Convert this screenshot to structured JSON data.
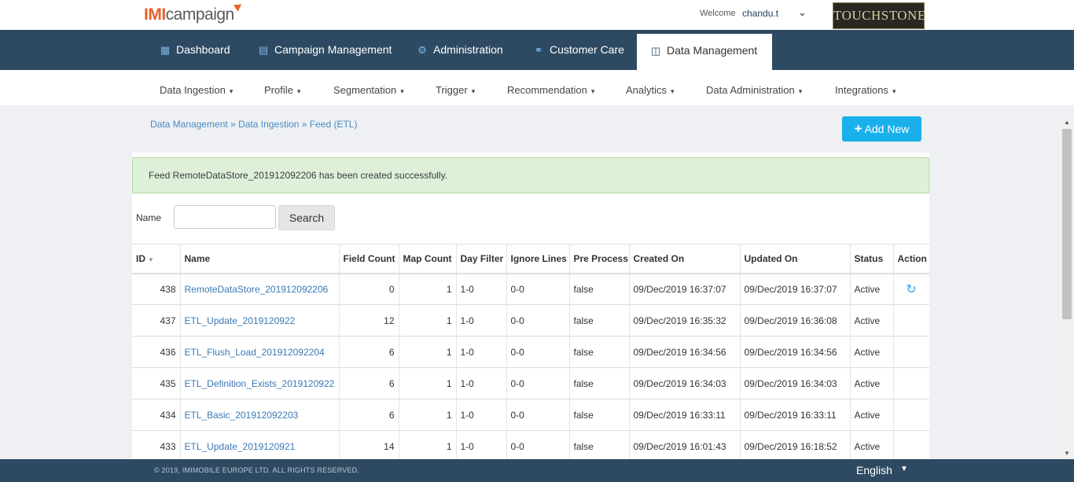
{
  "header": {
    "logo_imi": "IMI",
    "logo_campaign": "campaign",
    "welcome_label": "Welcome",
    "username": "chandu.t",
    "brand": "TOUCHSTONE"
  },
  "main_nav": {
    "items": [
      {
        "label": "Dashboard",
        "icon": "bar-chart-icon"
      },
      {
        "label": "Campaign Management",
        "icon": "document-icon"
      },
      {
        "label": "Administration",
        "icon": "gears-icon"
      },
      {
        "label": "Customer Care",
        "icon": "headset-icon"
      },
      {
        "label": "Data Management",
        "icon": "database-icon",
        "active": true
      }
    ]
  },
  "sub_nav": {
    "items": [
      {
        "label": "Data Ingestion"
      },
      {
        "label": "Profile"
      },
      {
        "label": "Segmentation"
      },
      {
        "label": "Trigger"
      },
      {
        "label": "Recommendation"
      },
      {
        "label": "Analytics"
      },
      {
        "label": "Data Administration"
      },
      {
        "label": "Integrations"
      }
    ]
  },
  "breadcrumb": "Data Management » Data Ingestion » Feed (ETL)",
  "add_new_label": "Add New",
  "alert_text": "Feed RemoteDataStore_201912092206 has been created successfully.",
  "filter": {
    "name_label": "Name",
    "name_value": "",
    "search_label": "Search"
  },
  "table": {
    "headers": {
      "id": "ID",
      "name": "Name",
      "field_count": "Field Count",
      "map_count": "Map Count",
      "day_filter": "Day Filter",
      "ignore_lines": "Ignore Lines",
      "pre_process": "Pre Process",
      "created_on": "Created On",
      "updated_on": "Updated On",
      "status": "Status",
      "action": "Action"
    },
    "rows": [
      {
        "id": "438",
        "name": "RemoteDataStore_201912092206",
        "field_count": "0",
        "map_count": "1",
        "day_filter": "1-0",
        "ignore_lines": "0-0",
        "pre_process": "false",
        "created_on": "09/Dec/2019 16:37:07",
        "updated_on": "09/Dec/2019 16:37:07",
        "status": "Active",
        "action_icon": "refresh-icon"
      },
      {
        "id": "437",
        "name": "ETL_Update_2019120922",
        "field_count": "12",
        "map_count": "1",
        "day_filter": "1-0",
        "ignore_lines": "0-0",
        "pre_process": "false",
        "created_on": "09/Dec/2019 16:35:32",
        "updated_on": "09/Dec/2019 16:36:08",
        "status": "Active"
      },
      {
        "id": "436",
        "name": "ETL_Flush_Load_201912092204",
        "field_count": "6",
        "map_count": "1",
        "day_filter": "1-0",
        "ignore_lines": "0-0",
        "pre_process": "false",
        "created_on": "09/Dec/2019 16:34:56",
        "updated_on": "09/Dec/2019 16:34:56",
        "status": "Active"
      },
      {
        "id": "435",
        "name": "ETL_Definition_Exists_2019120922",
        "field_count": "6",
        "map_count": "1",
        "day_filter": "1-0",
        "ignore_lines": "0-0",
        "pre_process": "false",
        "created_on": "09/Dec/2019 16:34:03",
        "updated_on": "09/Dec/2019 16:34:03",
        "status": "Active"
      },
      {
        "id": "434",
        "name": "ETL_Basic_201912092203",
        "field_count": "6",
        "map_count": "1",
        "day_filter": "1-0",
        "ignore_lines": "0-0",
        "pre_process": "false",
        "created_on": "09/Dec/2019 16:33:11",
        "updated_on": "09/Dec/2019 16:33:11",
        "status": "Active"
      },
      {
        "id": "433",
        "name": "ETL_Update_2019120921",
        "field_count": "14",
        "map_count": "1",
        "day_filter": "1-0",
        "ignore_lines": "0-0",
        "pre_process": "false",
        "created_on": "09/Dec/2019 16:01:43",
        "updated_on": "09/Dec/2019 16:18:52",
        "status": "Active"
      }
    ]
  },
  "footer": {
    "copyright": "© 2019, IMIMOBILE EUROPE LTD. ALL RIGHTS RESERVED.",
    "language": "English"
  },
  "colors": {
    "nav_bg": "#2e4a62",
    "accent": "#1ab0ec",
    "link": "#3a78b5",
    "alert_bg": "#dff0d8",
    "logo_orange": "#e8612c"
  }
}
